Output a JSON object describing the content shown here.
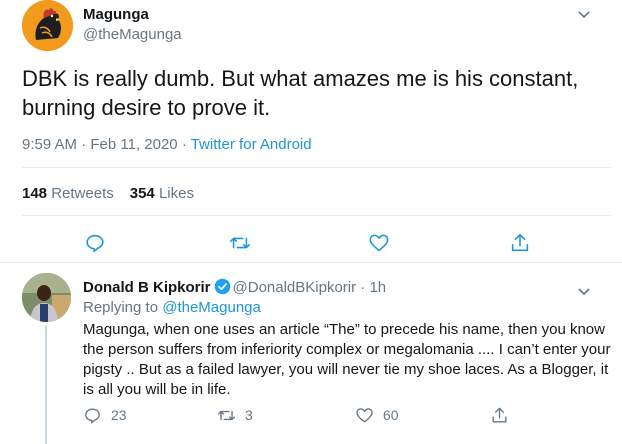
{
  "main_tweet": {
    "display_name": "Magunga",
    "handle": "@theMagunga",
    "text": "DBK is really dumb. But what amazes me is his constant, burning desire to prove it.",
    "time": "9:59 AM · Feb 11, 2020 · ",
    "source": "Twitter for Android",
    "retweets_count": "148",
    "retweets_label": "Retweets",
    "likes_count": "354",
    "likes_label": "Likes"
  },
  "reply_tweet": {
    "display_name": "Donald B Kipkorir",
    "handle_time": "@DonaldBKipkorir · 1h",
    "replying_prefix": "Replying to ",
    "replying_to": "@theMagunga",
    "text": "Magunga, when one uses an article “The” to precede his name, then you know the person suffers from inferiority complex or megalomania .... I can’t enter your pigsty .. But as a failed lawyer, you will never tie my shoe laces. As a Blogger, it is all you will be in life.",
    "replies": "23",
    "retweets": "3",
    "likes": "60"
  },
  "colors": {
    "text": "#14171a",
    "secondary": "#657786",
    "link": "#1b95e0",
    "divider": "#e6ecf0",
    "icon": "#1b95e0",
    "verified": "#1da1f2"
  },
  "icons": [
    "chevron-down-icon",
    "reply-icon",
    "retweet-icon",
    "like-icon",
    "share-icon",
    "verified-badge-icon"
  ]
}
